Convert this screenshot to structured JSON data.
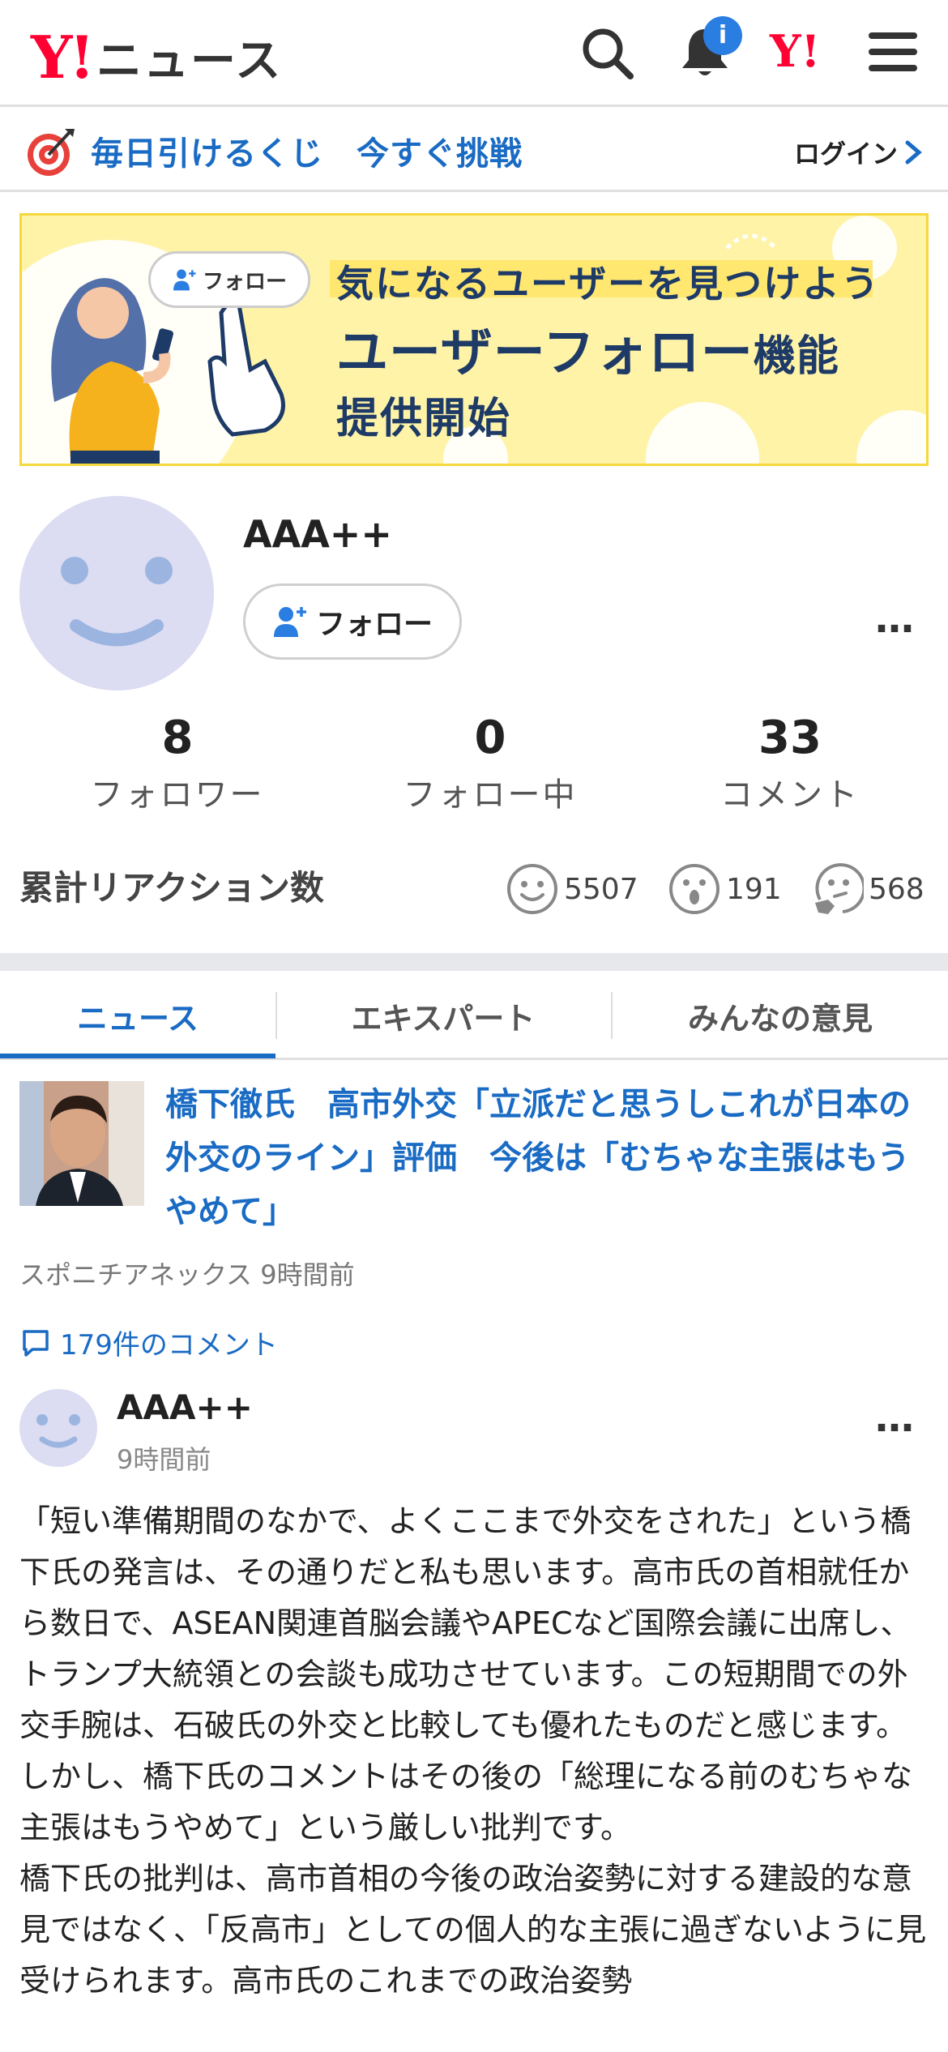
{
  "header": {
    "logo_mark": "Y!",
    "logo_text": "ニュース",
    "notification_badge": "i",
    "yj_mark": "Y!",
    "icons": [
      "search-icon",
      "bell-icon",
      "yahoo-japan-icon",
      "menu-icon"
    ]
  },
  "lottery": {
    "text": "毎日引けるくじ　今すぐ挑戦",
    "login_label": "ログイン"
  },
  "banner": {
    "pill_label": "フォロー",
    "line1": "気になるユーザーを見つけよう",
    "line2_main": "ユーザーフォロー",
    "line2_suffix": "機能",
    "line3": "提供開始"
  },
  "profile": {
    "name": "AAA++",
    "follow_label": "フォロー",
    "more": "…",
    "stats": [
      {
        "value": "8",
        "label": "フォロワー"
      },
      {
        "value": "0",
        "label": "フォロー中"
      },
      {
        "value": "33",
        "label": "コメント"
      }
    ],
    "reactions_title": "累計リアクション数",
    "reactions": [
      {
        "icon": "smile-face-icon",
        "count": "5507"
      },
      {
        "icon": "surprised-face-icon",
        "count": "191"
      },
      {
        "icon": "thinking-face-icon",
        "count": "568"
      }
    ]
  },
  "tabs": [
    {
      "label": "ニュース",
      "active": true
    },
    {
      "label": "エキスパート",
      "active": false
    },
    {
      "label": "みんなの意見",
      "active": false
    }
  ],
  "article": {
    "title": "橋下徹氏　高市外交「立派だと思うしこれが日本の外交のライン」評価　今後は「むちゃな主張はもうやめて」",
    "source": "スポニチアネックス",
    "time": "9時間前",
    "comment_count_label": "179件のコメント"
  },
  "comment": {
    "user": "AAA++",
    "time": "9時間前",
    "more": "…",
    "body": "「短い準備期間のなかで、よくここまで外交をされた」という橋下氏の発言は、その通りだと私も思います。高市氏の首相就任から数日で、ASEAN関連首脳会議やAPECなど国際会議に出席し、トランプ大統領との会談も成功させています。この短期間での外交手腕は、石破氏の外交と比較しても優れたものだと感じます。しかし、橋下氏のコメントはその後の「総理になる前のむちゃな主張はもうやめて」という厳しい批判です。\n橋下氏の批判は、高市首相の今後の政治姿勢に対する建設的な意見ではなく、「反高市」としての個人的な主張に過ぎないように見受けられます。高市氏のこれまでの政治姿勢"
  },
  "colors": {
    "brand_red": "#ff0033",
    "link_blue": "#1a6bc4",
    "badge_blue": "#2a7de1",
    "avatar_bg": "#dcdcf2",
    "avatar_face": "#9bb5e0",
    "banner_yellow": "#fff3a8"
  }
}
